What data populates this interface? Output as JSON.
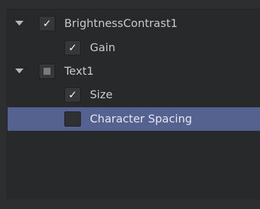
{
  "tree": {
    "items": [
      {
        "label": "BrightnessContrast1",
        "level": 0,
        "expanded": true,
        "state": "checked",
        "selected": false
      },
      {
        "label": "Gain",
        "level": 1,
        "state": "checked",
        "selected": false
      },
      {
        "label": "Text1",
        "level": 0,
        "expanded": true,
        "state": "partial",
        "selected": false
      },
      {
        "label": "Size",
        "level": 1,
        "state": "checked",
        "selected": false
      },
      {
        "label": "Character Spacing",
        "level": 1,
        "state": "unchecked",
        "selected": true
      }
    ],
    "checkmark_glyph": "✓",
    "colors": {
      "selection": "#556290",
      "background": "#28292c",
      "text": "#c9cacc"
    },
    "icons": {
      "expand": "triangle-down-icon",
      "checked": "checkmark-icon",
      "partial": "partial-square-icon"
    }
  }
}
